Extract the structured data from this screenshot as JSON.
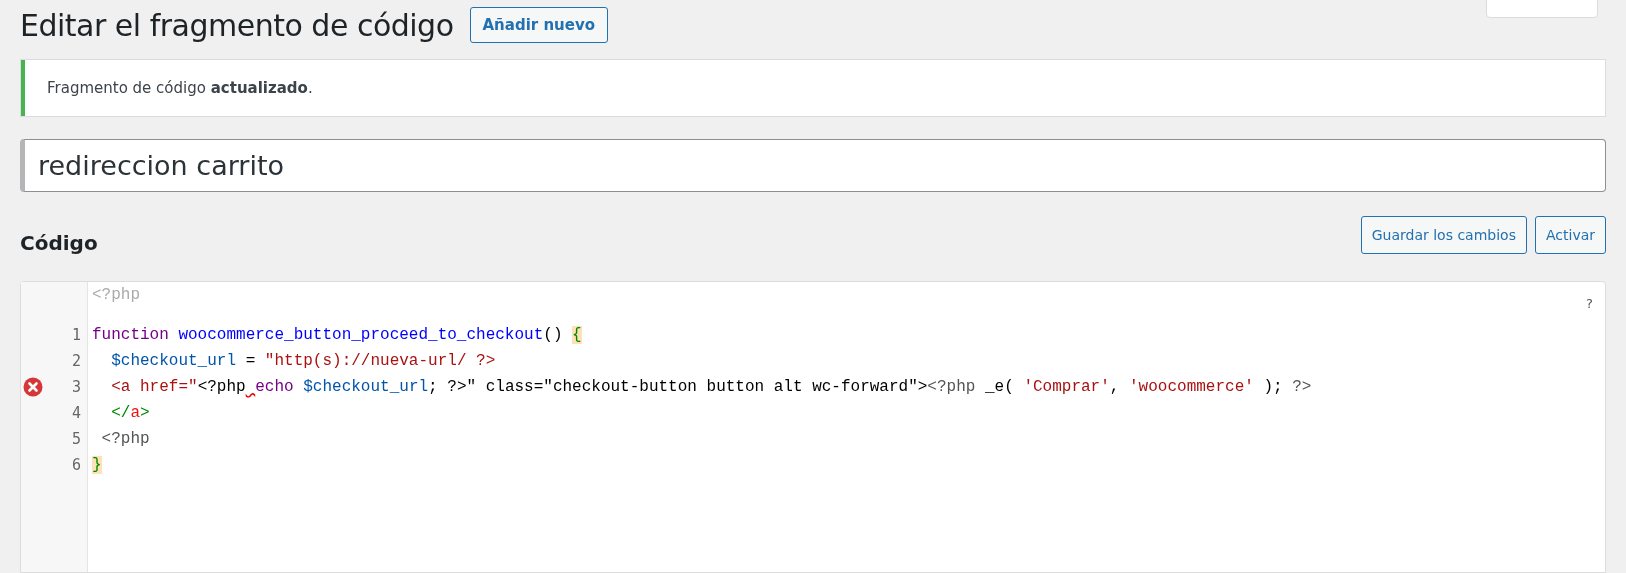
{
  "page_title": "Editar el fragmento de código",
  "add_new_button": "Añadir nuevo",
  "notice": {
    "text": "Fragmento de código **actualizado**.",
    "color": "#46b450"
  },
  "snippet_title": {
    "value": "redireccion carrito"
  },
  "code_section": {
    "heading": "Código",
    "buttons": [
      "Guardar los cambios",
      "Activar"
    ]
  },
  "editor": {
    "header": "<?php",
    "help": "?",
    "lines": [
      {
        "number": "1",
        "error": false,
        "tokens": [
          {
            "kind": "keyword",
            "text": "function"
          },
          {
            "kind": "function",
            "text": " woocommerce_button_proceed_to_checkout"
          },
          {
            "kind": "plain",
            "text": "() "
          },
          {
            "kind": "bracket",
            "text": "{"
          }
        ]
      },
      {
        "number": "2",
        "error": false,
        "tokens": [
          {
            "kind": "variable",
            "text": "  $checkout_url"
          },
          {
            "kind": "plain",
            "text": " = "
          },
          {
            "kind": "string",
            "text": "\"http(s)://nueva-url/ ?>"
          }
        ]
      },
      {
        "number": "3",
        "error": true,
        "tokens": [
          {
            "kind": "tag",
            "text": "  <a"
          },
          {
            "kind": "attr",
            "text": " href=\""
          },
          {
            "kind": "plain",
            "text": "<?php"
          },
          {
            "kind": "keyword",
            "text": " echo",
            "squiggle": true
          },
          {
            "kind": "variable",
            "text": " $checkout_url"
          },
          {
            "kind": "plain",
            "text": "; ?>\" class=\"checkout-button button alt wc-forward\">"
          },
          {
            "kind": "meta",
            "text": "<?php"
          },
          {
            "kind": "plain",
            "text": " _e( "
          },
          {
            "kind": "string",
            "text": "'Comprar'"
          },
          {
            "kind": "plain",
            "text": ", "
          },
          {
            "kind": "string",
            "text": "'woocommerce'"
          },
          {
            "kind": "plain",
            "text": " ); "
          },
          {
            "kind": "meta",
            "text": "?>"
          }
        ]
      },
      {
        "number": "4",
        "error": false,
        "tokens": [
          {
            "kind": "tagpunct",
            "text": "  </"
          },
          {
            "kind": "tagname",
            "text": "a"
          },
          {
            "kind": "tagpunct",
            "text": ">"
          }
        ]
      },
      {
        "number": "5",
        "error": false,
        "tokens": [
          {
            "kind": "meta",
            "text": " <?php"
          }
        ]
      },
      {
        "number": "6",
        "error": false,
        "tokens": [
          {
            "kind": "bracket",
            "text": "}"
          }
        ]
      }
    ]
  }
}
